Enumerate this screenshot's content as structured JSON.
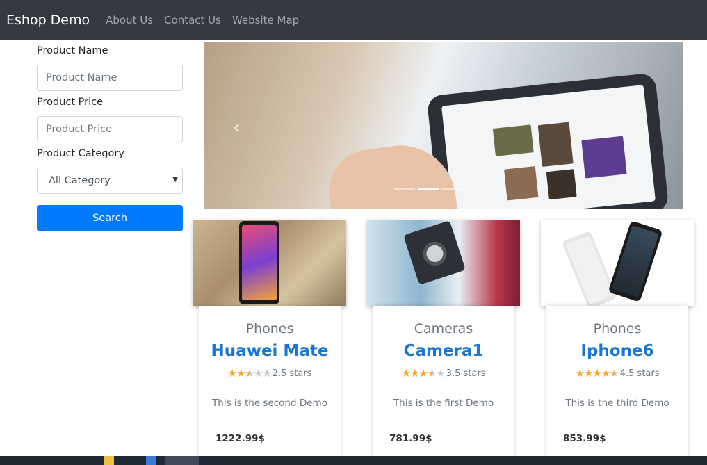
{
  "navbar": {
    "brand": "Eshop Demo",
    "links": [
      "About Us",
      "Contact Us",
      "Website Map"
    ]
  },
  "filter": {
    "name_label": "Product Name",
    "name_placeholder": "Product Name",
    "price_label": "Product Price",
    "price_placeholder": "Product Price",
    "category_label": "Product Category",
    "category_value": "All Category",
    "search_label": "Search"
  },
  "carousel": {
    "prev_icon": "chevron-left-icon",
    "next_icon": "chevron-right-icon",
    "slides": 3,
    "active_slide": 2
  },
  "products": [
    {
      "category": "Phones",
      "title": "Huawei Mate",
      "stars": 2.5,
      "rating_text": "2.5 stars",
      "description": "This is the second Demo",
      "price": "1222.99$"
    },
    {
      "category": "Cameras",
      "title": "Camera1",
      "stars": 3.5,
      "rating_text": "3.5 stars",
      "description": "This is the first Demo",
      "price": "781.99$"
    },
    {
      "category": "Phones",
      "title": "Iphone6",
      "stars": 4.5,
      "rating_text": "4.5 stars",
      "description": "This is the third Demo",
      "price": "853.99$"
    }
  ],
  "colors": {
    "navbar": "#343a40",
    "primary": "#007bff",
    "title_link": "#1976d2",
    "star": "#f5a623"
  }
}
